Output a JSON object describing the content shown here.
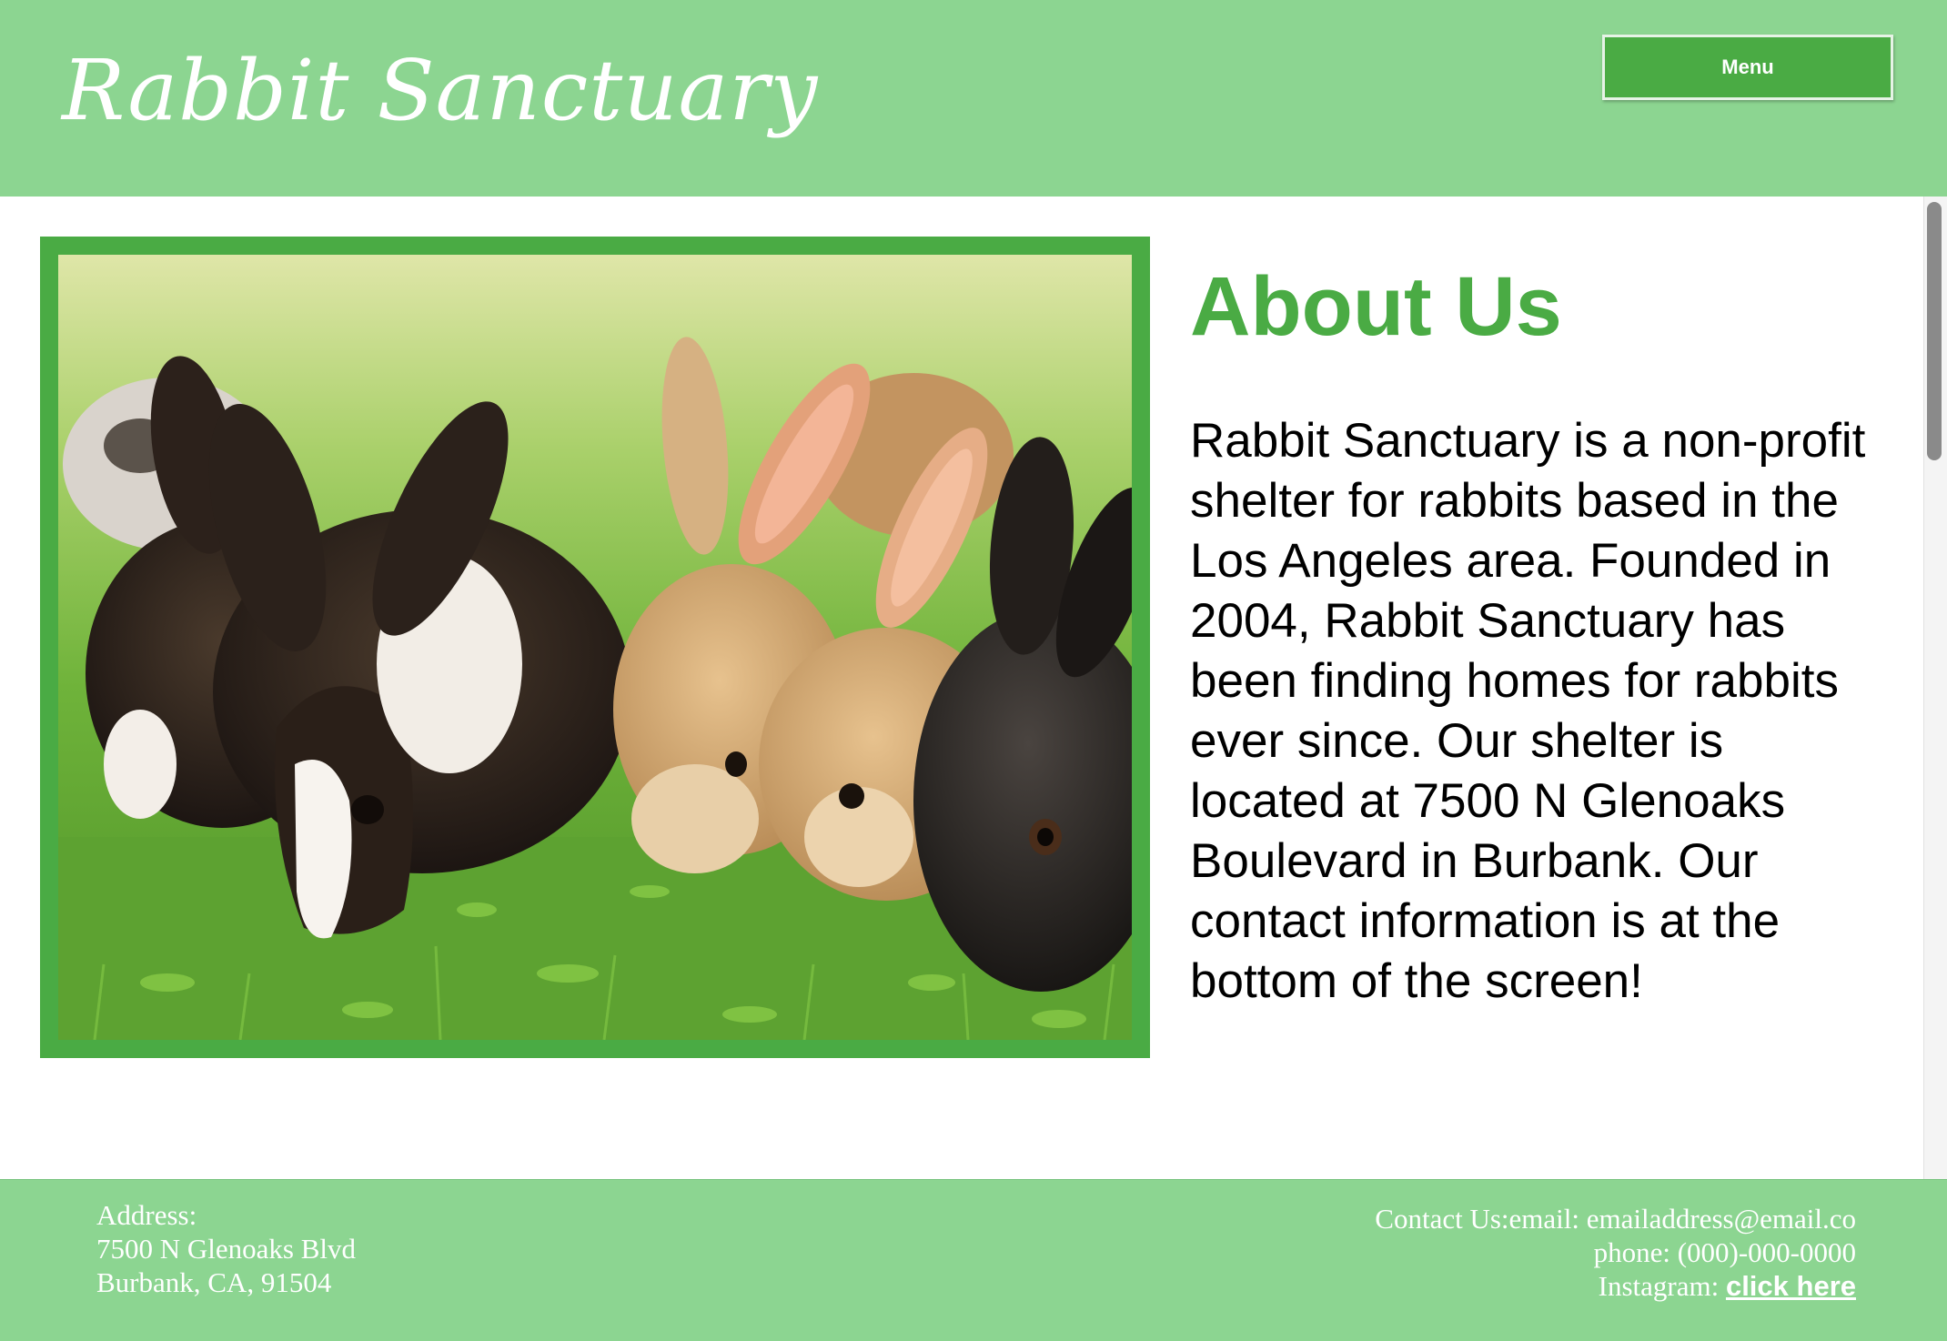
{
  "header": {
    "site_title": "Rabbit Sanctuary",
    "menu_label": "Menu"
  },
  "main": {
    "image_alt": "Rabbits grazing on grass",
    "about_title": "About Us",
    "about_text": "Rabbit Sanctuary is a non-profit shelter for rabbits based in the Los Angeles area. Founded in 2004, Rabbit Sanctuary has been finding homes for rabbits ever since. Our shelter is located at 7500 N Glenoaks Boulevard in Burbank. Our contact information is at the bottom of the screen!"
  },
  "footer": {
    "address_label": "Address:",
    "address_line1": "7500 N Glenoaks Blvd",
    "address_line2": "Burbank, CA, 91504",
    "contact_email_line": "Contact Us:email: emailaddress@email.co",
    "phone_line": "phone: (000)-000-0000",
    "instagram_label": "Instagram: ",
    "instagram_link": "click here"
  },
  "colors": {
    "header_bg": "#8cd591",
    "accent_green": "#4aab44",
    "text_white": "#ffffff"
  },
  "icons": {
    "photo": "rabbits-photo"
  }
}
